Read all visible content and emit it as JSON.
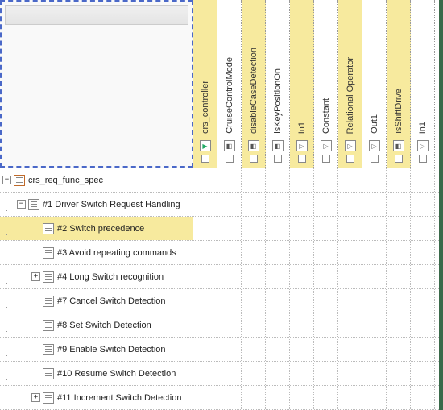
{
  "columns": [
    {
      "id": "crs_controller",
      "label": "crs_controller",
      "highlight": true,
      "iconType": "arrow"
    },
    {
      "id": "CruiseControlMode",
      "label": "CruiseControlMode",
      "highlight": false,
      "iconType": "block"
    },
    {
      "id": "disableCaseDetection",
      "label": "disableCaseDetection",
      "highlight": true,
      "iconType": "block"
    },
    {
      "id": "isKeyPositionOn",
      "label": "isKeyPositionOn",
      "highlight": false,
      "iconType": "block"
    },
    {
      "id": "In1_a",
      "label": "In1",
      "highlight": true,
      "iconType": "port"
    },
    {
      "id": "Constant",
      "label": "Constant",
      "highlight": false,
      "iconType": "port"
    },
    {
      "id": "RelationalOperator",
      "label": "Relational Operator",
      "highlight": true,
      "iconType": "port"
    },
    {
      "id": "Out1",
      "label": "Out1",
      "highlight": false,
      "iconType": "port"
    },
    {
      "id": "isShiftDrive",
      "label": "isShiftDrive",
      "highlight": true,
      "iconType": "block"
    },
    {
      "id": "In1_b",
      "label": "In1",
      "highlight": false,
      "iconType": "port"
    }
  ],
  "rows": [
    {
      "id": "crs_req_func_spec",
      "label": "crs_req_func_spec",
      "depth": 0,
      "expander": "minus",
      "icon": "root",
      "highlight": false
    },
    {
      "id": "r1",
      "label": "#1 Driver Switch Request Handling",
      "depth": 1,
      "expander": "minus",
      "icon": "req",
      "highlight": false
    },
    {
      "id": "r2",
      "label": "#2 Switch precedence",
      "depth": 2,
      "expander": "none",
      "icon": "req",
      "highlight": true
    },
    {
      "id": "r3",
      "label": "#3 Avoid repeating commands",
      "depth": 2,
      "expander": "none",
      "icon": "req",
      "highlight": false
    },
    {
      "id": "r4",
      "label": "#4 Long Switch recognition",
      "depth": 2,
      "expander": "plus",
      "icon": "req",
      "highlight": false
    },
    {
      "id": "r7",
      "label": "#7 Cancel Switch Detection",
      "depth": 2,
      "expander": "none",
      "icon": "req",
      "highlight": false
    },
    {
      "id": "r8",
      "label": "#8 Set Switch Detection",
      "depth": 2,
      "expander": "none",
      "icon": "req",
      "highlight": false
    },
    {
      "id": "r9",
      "label": "#9 Enable Switch Detection",
      "depth": 2,
      "expander": "none",
      "icon": "req",
      "highlight": false
    },
    {
      "id": "r10",
      "label": "#10 Resume Switch Detection",
      "depth": 2,
      "expander": "none",
      "icon": "req",
      "highlight": false
    },
    {
      "id": "r11",
      "label": "#11 Increment Switch Detection",
      "depth": 2,
      "expander": "plus",
      "icon": "req",
      "highlight": false
    }
  ],
  "expanderGlyph": {
    "plus": "+",
    "minus": "−"
  }
}
